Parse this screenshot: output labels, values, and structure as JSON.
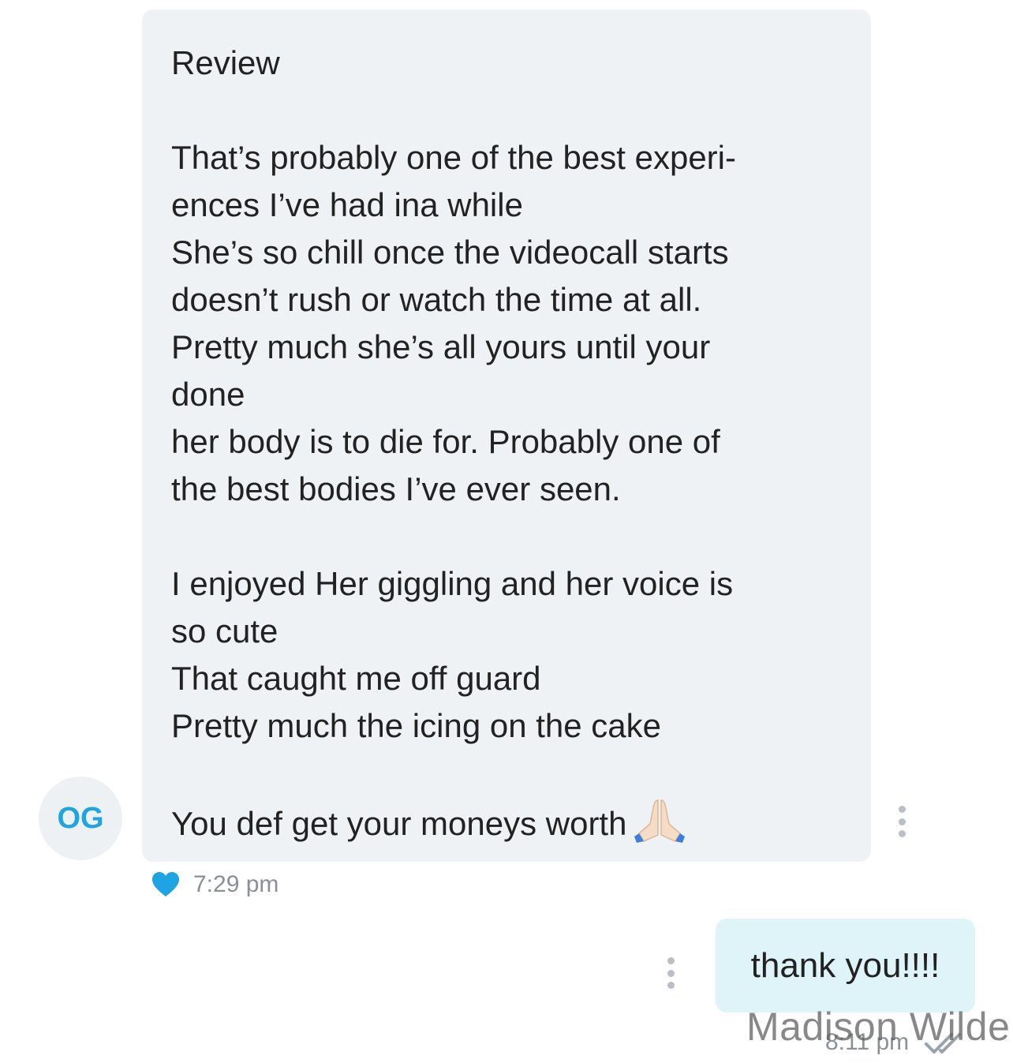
{
  "incoming": {
    "avatar_initials": "OG",
    "lines": [
      "Review",
      "",
      "That’s probably one of the best experi-",
      "ences I’ve had ina while",
      "She’s so chill once the videocall starts",
      "doesn’t rush or watch the time at all.",
      "Pretty much she’s all yours until your",
      "done",
      "her body is to die for. Probably one of",
      "the best bodies I’ve ever seen.",
      "",
      "I enjoyed Her giggling and her voice is",
      "so cute",
      "That caught me off guard",
      "Pretty much the icing on the cake",
      "",
      "You def get your moneys worth"
    ],
    "emoji_icon": "folded-hands-icon",
    "time": "7:29 pm",
    "reaction_icon": "heart-icon",
    "reaction_color": "#1ea3e3"
  },
  "outgoing": {
    "text": "thank you!!!!",
    "time": "8:11 pm",
    "status_icon": "double-check-icon"
  },
  "watermark": "Madison Wilde",
  "colors": {
    "incoming_bubble": "#eff2f4",
    "outgoing_bubble": "#def4f9",
    "avatar_text": "#1fa6e0",
    "timestamp": "#8a9096"
  }
}
